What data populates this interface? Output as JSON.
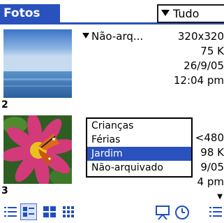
{
  "header": {
    "title": "Fotos",
    "category_selected": "Tudo"
  },
  "photos": [
    {
      "index": "2",
      "category": "Não-arq...",
      "dimensions": "320x320",
      "size": "75 K",
      "date": "26/9/05",
      "time": "12:04 pm"
    },
    {
      "index": "3",
      "dimensions_partial": "<480",
      "size_partial": "98 K",
      "date_partial": "9/05",
      "time_partial": "4 pm"
    }
  ],
  "category_popup": {
    "items": [
      "Crianças",
      "Férias",
      "Jardim",
      "Não-arquivado"
    ],
    "selected_index": 2
  },
  "toolbar": {
    "icons": [
      "list-view-icon",
      "detail-view-icon",
      "thumbnail-large-icon",
      "thumbnail-small-icon",
      "slideshow-icon",
      "clock-icon",
      "menu-icon"
    ]
  },
  "colors": {
    "accent": "#2a52be",
    "icon_blue": "#1f4fbf"
  }
}
